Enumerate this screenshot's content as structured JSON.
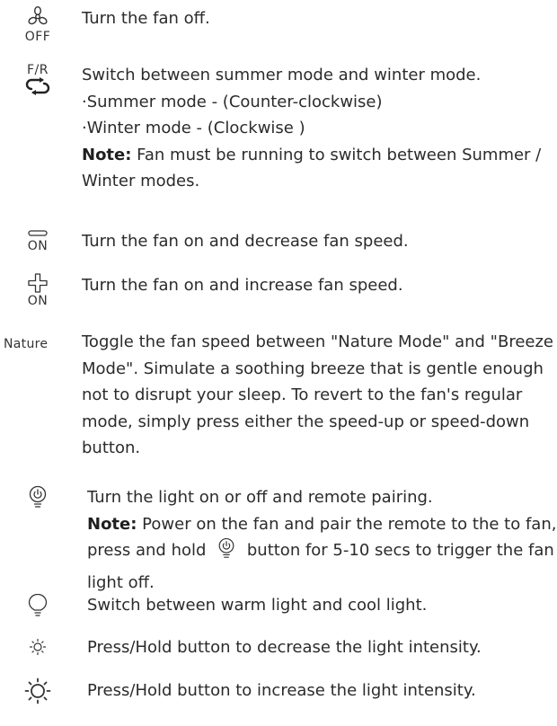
{
  "rows": {
    "off": {
      "icon": "fan-icon",
      "caption": "OFF",
      "text": "Turn the fan off."
    },
    "fr": {
      "icon": "reverse-arrows-icon",
      "caption": "F/R",
      "text": "Switch between summer mode and winter mode.",
      "bullets": [
        "·Summer mode - (Counter-clockwise)",
        "·Winter mode - (Clockwise )"
      ],
      "note_label": "Note:",
      "note_text": " Fan must be running to switch between Summer / Winter modes."
    },
    "minus_on": {
      "icon": "minus-icon",
      "caption": "ON",
      "text": "Turn the fan on and decrease fan speed."
    },
    "plus_on": {
      "icon": "plus-icon",
      "caption": "ON",
      "text": "Turn the fan on and increase fan speed."
    },
    "nature": {
      "caption": "Nature",
      "text": "Toggle the fan speed between \"Nature Mode\" and \"Breeze Mode\". Simulate a soothing breeze that is gentle enough not to disrupt your sleep. To revert to the fan's regular mode, simply press either the speed-up or speed-down button."
    },
    "light_power": {
      "icon": "bulb-power-icon",
      "text": "Turn the light on or off and remote pairing.",
      "note_label": "Note:",
      "note_text_1": " Power on the fan and pair the remote to the to fan, press and hold ",
      "note_text_2": " button for 5-10 secs to trigger the fan light off."
    },
    "warm_cool": {
      "icon": "bulb-icon",
      "text": "Switch between warm light and cool light."
    },
    "dim": {
      "icon": "sun-small-icon",
      "text": "Press/Hold button to decrease the light intensity."
    },
    "bright": {
      "icon": "sun-large-icon",
      "text": "Press/Hold button to increase the light intensity."
    }
  }
}
